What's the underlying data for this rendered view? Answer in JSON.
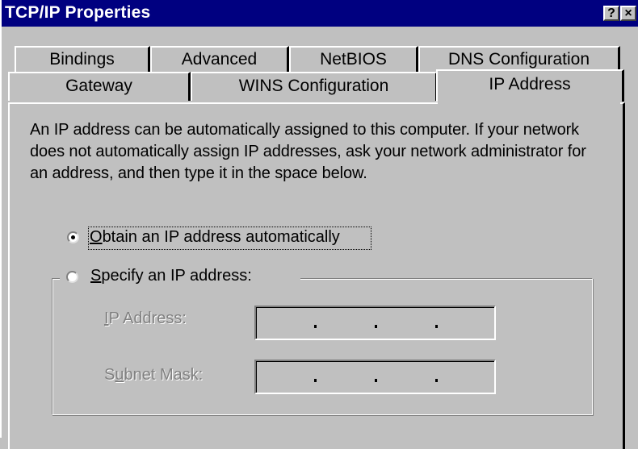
{
  "window": {
    "title": "TCP/IP Properties",
    "help_label": "?",
    "close_label": "×"
  },
  "tabs": {
    "row1": [
      {
        "label": "Bindings"
      },
      {
        "label": "Advanced"
      },
      {
        "label": "NetBIOS"
      },
      {
        "label": "DNS Configuration"
      }
    ],
    "row2": [
      {
        "label": "Gateway"
      },
      {
        "label": "WINS Configuration"
      },
      {
        "label": "IP Address",
        "active": true
      }
    ]
  },
  "description": "An IP address can be automatically assigned to this computer.  If your network does not automatically assign IP addresses, ask your network administrator for an address, and then type it in the space below.",
  "options": {
    "obtain": {
      "mnemonic": "O",
      "rest": "btain an IP address automatically",
      "selected": true
    },
    "specify": {
      "mnemonic": "S",
      "rest": "pecify an IP address:",
      "selected": false
    }
  },
  "fields": {
    "ip_address": {
      "mnemonic": "I",
      "rest": "P Address:",
      "value": [
        "",
        "",
        "",
        ""
      ],
      "enabled": false
    },
    "subnet_mask": {
      "pre": "S",
      "mnemonic": "u",
      "rest": "bnet Mask:",
      "value": [
        "",
        "",
        "",
        ""
      ],
      "enabled": false
    }
  }
}
